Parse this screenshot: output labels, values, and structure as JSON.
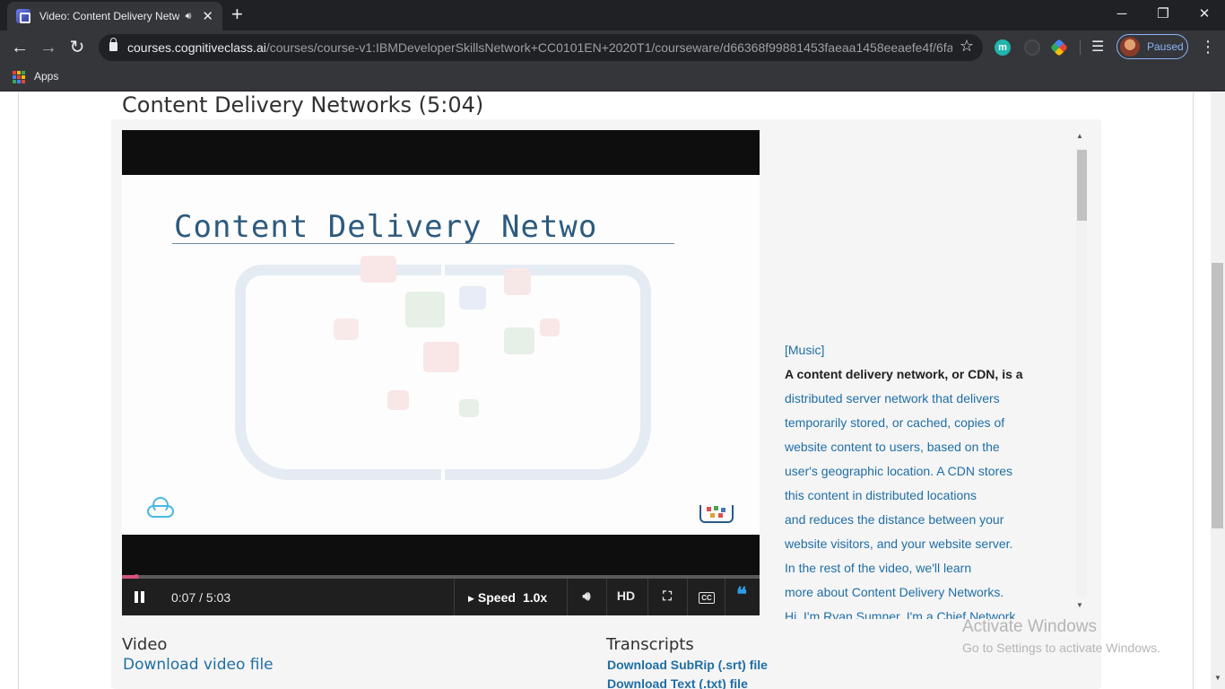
{
  "browser": {
    "tab_title": "Video: Content Delivery Netw",
    "url_host": "courses.cognitiveclass.ai",
    "url_path": "/courses/course-v1:IBMDeveloperSkillsNetwork+CC0101EN+2020T1/courseware/d66368f99881453faeaa1458eeaefe4f/6fa...",
    "profile_status": "Paused",
    "ext_m_label": "m",
    "bookmarks_apps": "Apps"
  },
  "page": {
    "video_title": "Content Delivery Networks (5:04)"
  },
  "video": {
    "slide_title": "Content Delivery Netwo",
    "time": "0:07 / 5:03",
    "progress_fraction": 0.023,
    "speed_label": "Speed",
    "speed_value": "1.0x",
    "hd_label": "HD"
  },
  "transcript": {
    "lines": [
      "[Music]",
      "A content delivery network, or CDN, is a",
      "distributed server network that delivers",
      "temporarily stored, or cached, copies of",
      "website content to users, based on the",
      "user's geographic location. A CDN stores",
      "this content in distributed locations",
      "and reduces the distance between your",
      "website visitors, and your website server.",
      "In the rest of the video, we'll learn",
      "more about Content Delivery Networks.",
      "Hi, I'm Ryan Sumner, I'm a Chief Network"
    ],
    "current_index": 1
  },
  "downloads": {
    "video_heading": "Video",
    "video_link": "Download video file",
    "transcripts_heading": "Transcripts",
    "srt_link": "Download SubRip (.srt) file",
    "txt_link": "Download Text (.txt) file"
  },
  "watermark": {
    "title": "Activate Windows",
    "subtitle": "Go to Settings to activate Windows."
  },
  "colors": {
    "link": "#1f6ea5",
    "progress": "#d4537b",
    "transcript_accent": "#2a9ee8"
  }
}
